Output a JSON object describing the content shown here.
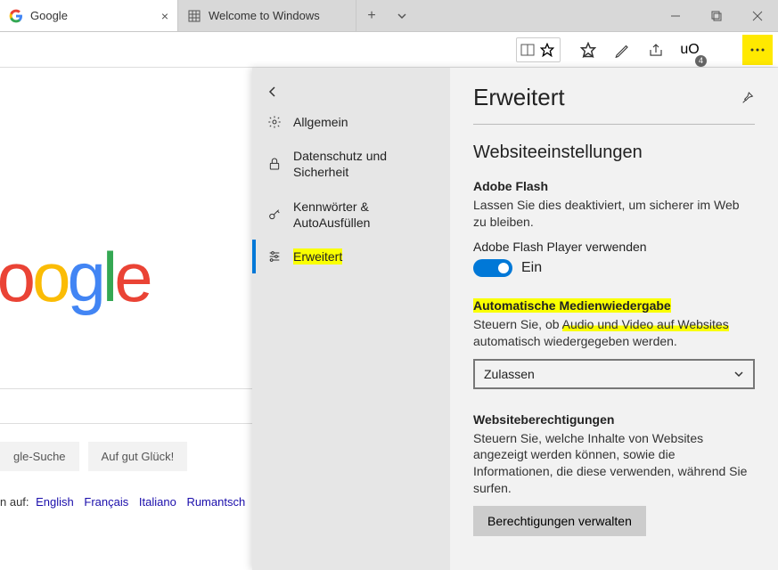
{
  "tabs": [
    {
      "title": "Google"
    },
    {
      "title": "Welcome to Windows"
    }
  ],
  "ext_badge": "4",
  "google": {
    "btn1": "gle-Suche",
    "btn2": "Auf gut Glück!",
    "lang_prefix": "n auf:  ",
    "langs": [
      "English",
      "Français",
      "Italiano",
      "Rumantsch"
    ]
  },
  "nav": {
    "items": [
      "Allgemein",
      "Datenschutz und Sicherheit",
      "Kennwörter & AutoAusfüllen",
      "Erweitert"
    ]
  },
  "panel": {
    "title": "Erweitert",
    "section": "Websiteeinstellungen",
    "flash": {
      "title": "Adobe Flash",
      "desc": "Lassen Sie dies deaktiviert, um sicherer im Web zu bleiben.",
      "label": "Adobe Flash Player verwenden",
      "state": "Ein"
    },
    "media": {
      "title": "Automatische Medienwiedergabe",
      "desc_pre": "Steuern Sie, ob ",
      "desc_hl": "Audio und Video auf Websites",
      "desc_post": " automatisch wiedergegeben werden.",
      "select": "Zulassen"
    },
    "perm": {
      "title": "Websiteberechtigungen",
      "desc": "Steuern Sie, welche Inhalte von Websites angezeigt werden können, sowie die Informationen, die diese verwenden, während Sie surfen.",
      "button": "Berechtigungen verwalten"
    }
  }
}
